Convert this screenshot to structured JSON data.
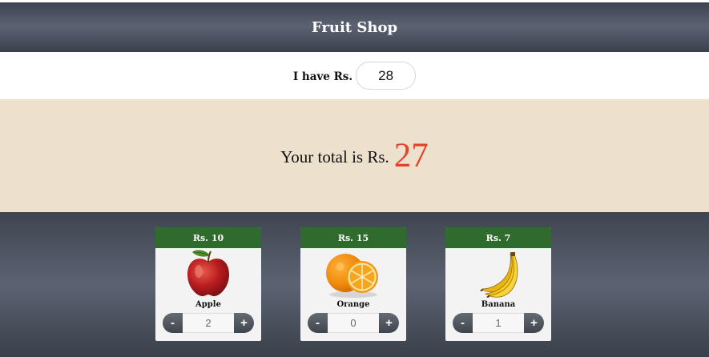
{
  "header": {
    "title": "Fruit Shop"
  },
  "budget": {
    "label": "I have Rs.",
    "value": "28"
  },
  "total": {
    "label": "Your total is Rs.",
    "value": "27"
  },
  "fruits": [
    {
      "name": "Apple",
      "price": "Rs. 10",
      "quantity": "2",
      "icon": "apple-icon"
    },
    {
      "name": "Orange",
      "price": "Rs. 15",
      "quantity": "0",
      "icon": "orange-icon"
    },
    {
      "name": "Banana",
      "price": "Rs. 7",
      "quantity": "1",
      "icon": "banana-icon"
    }
  ],
  "stepper": {
    "minus_label": "-",
    "plus_label": "+"
  },
  "colors": {
    "header_bg": "#5b6373",
    "total_band": "#ede0cc",
    "total_value": "#e0452a",
    "price_bar": "#2f6b2c",
    "card_bg": "#f3f3f3"
  }
}
